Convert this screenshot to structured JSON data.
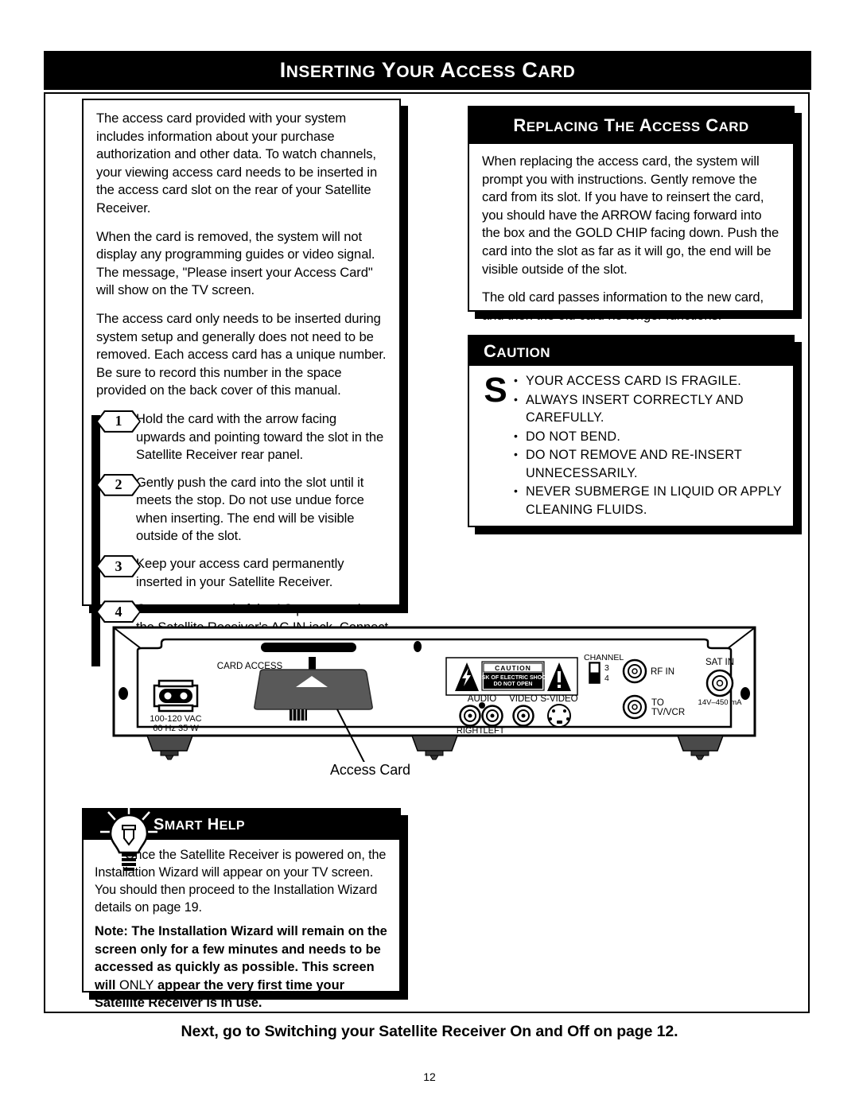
{
  "page": {
    "title": "INSERTING YOUR ACCESS CARD",
    "title_parts": [
      "I",
      "NSERTING",
      " Y",
      "OUR",
      " A",
      "CCESS",
      " C",
      "ARD"
    ],
    "number": "12",
    "footer_note": "Next, go to Switching your Satellite Receiver On and Off on page 12."
  },
  "left_column": {
    "paragraphs": [
      "The access card provided with your system includes information about your purchase authorization and other data. To watch channels, your viewing access card needs to be inserted in the access card slot on the rear of your Satellite Receiver.",
      "When the card is removed, the system will not display any programming guides or video signal. The message, \"Please insert your Access Card\" will show on the TV screen.",
      "The access card only needs to be inserted during system setup and generally does not need to be removed. Each access card has a unique number. Be sure to record this number in the space provided on the back cover of this manual."
    ],
    "steps": [
      {
        "number": "1",
        "text": "Hold the card with the arrow facing upwards and pointing toward the slot in the Satellite Receiver rear panel."
      },
      {
        "number": "2",
        "text": "Gently push the card into the slot until it meets the stop. Do not use undue force when inserting. The end will be visible outside of the slot."
      },
      {
        "number": "3",
        "text": "Keep your access card permanently inserted in your Satellite Receiver."
      },
      {
        "number": "4",
        "text": "Connect one end of the AC power cord to the Satellite Receiver's AC IN jack. Connect the plug end to an AC outlet. This will turn unit on."
      }
    ]
  },
  "replacing_box": {
    "heading": "REPLACING THE ACCESS CARD",
    "heading_parts": [
      "R",
      "EPLACING",
      " T",
      "HE",
      " A",
      "CCESS",
      " C",
      "ARD"
    ],
    "paragraphs": [
      "When replacing the access card, the system will prompt you with instructions. Gently remove the card from its slot. If you have to reinsert the card, you should have the ARROW facing forward into the box and the GOLD CHIP facing down. Push the card into the slot as far as it will go, the end will be visible outside of the slot.",
      "The old card passes information to the new card, and then the old card no longer functions."
    ]
  },
  "caution_box": {
    "heading": "CAUTION",
    "heading_parts": [
      "C",
      "AUTION"
    ],
    "glyph": "S",
    "items": [
      "YOUR ACCESS CARD IS FRAGILE.",
      "ALWAYS INSERT CORRECTLY AND CAREFULLY.",
      "DO NOT BEND.",
      "DO NOT REMOVE AND RE-INSERT UNNECESSARILY.",
      "NEVER SUBMERGE IN LIQUID OR APPLY CLEANING FLUIDS."
    ]
  },
  "smart_help": {
    "heading": "SMART HELP",
    "heading_parts": [
      "S",
      "MART",
      " H",
      "ELP"
    ],
    "body": "Once the Satellite Receiver is powered on, the Installation Wizard will appear on your TV screen. You should then proceed to the Installation Wizard details on page 19.",
    "note_prefix": "Note: The Installation Wizard will remain on the screen only for a few minutes and needs to be accessed as quickly as possible. This screen will ",
    "note_only": "ONLY",
    "note_suffix": " appear the very first time your Satellite Receiver is in use."
  },
  "receiver_diagram": {
    "callout_label": "Access Card",
    "labels": {
      "card_access": "CARD ACCESS",
      "power_rating_line1": "100-120 VAC",
      "power_rating_line2": "60 Hz  35 W",
      "caution_title": "C A U T I O N",
      "caution_line1": "RISK OF ELECTRIC SHOCK",
      "caution_line2": "DO NOT OPEN",
      "channel": "CHANNEL",
      "channel_option_top": "3",
      "channel_option_bottom": "4",
      "rf_in": "RF IN",
      "to_tv_vcr_line1": "TO",
      "to_tv_vcr_line2": "TV/VCR",
      "sat_in": "SAT IN",
      "sat_in_rating": "14V–450 mA",
      "audio": "AUDIO",
      "video": "VIDEO",
      "s_video": "S-VIDEO",
      "right": "RIGHT",
      "left": "LEFT"
    }
  },
  "colors": {
    "ink": "#000000",
    "paper": "#ffffff",
    "card_fill": "#595959",
    "foot_fill": "#555555"
  }
}
